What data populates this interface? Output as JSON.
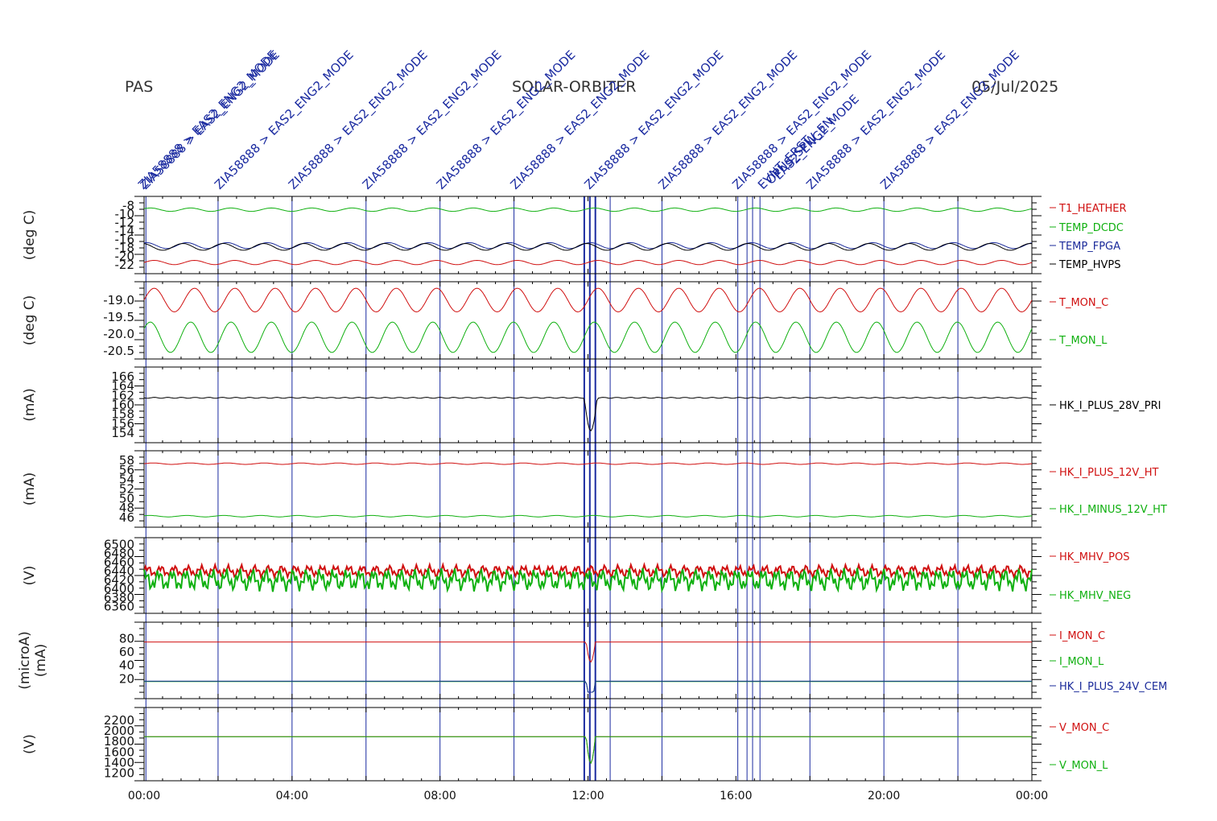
{
  "header": {
    "left": "PAS",
    "center": "SOLAR-ORBITER",
    "right": "05/Jul/2025"
  },
  "colors": {
    "red": "#d01010",
    "green": "#10b010",
    "blue": "#1a2a9a",
    "black": "#000000",
    "event": "#1a2aa0"
  },
  "events": {
    "label_text": "ZIA58888 > EAS2_ENG2_MODE",
    "times_hours": [
      2,
      4,
      6,
      8,
      10,
      12,
      14,
      16,
      18,
      20,
      22
    ],
    "lines_hours": [
      0.05,
      2.0,
      4.0,
      6.0,
      8.0,
      10.0,
      11.9,
      12.05,
      12.2,
      12.6,
      14.0,
      16.05,
      16.3,
      16.45,
      16.65,
      18.0,
      20.0,
      22.0
    ],
    "extra_labels": [
      "EVNT_ERST",
      "OPUS_SPW_EN",
      "EAS2_ENG2_MODE"
    ]
  },
  "chart_data": [
    {
      "type": "line",
      "panel": "temperatures",
      "ylabel": "(deg C)",
      "y_ticks": [
        "-8",
        "-10",
        "-12",
        "-14",
        "-16",
        "-18",
        "-20",
        "-22"
      ],
      "ylim": [
        -23,
        -7
      ],
      "series": [
        {
          "name": "T1_HEATHER",
          "color": "#d01010",
          "mean": -21.5,
          "amp": 0.5
        },
        {
          "name": "TEMP_DCDC",
          "color": "#10b010",
          "mean": -9.0,
          "amp": 0.4
        },
        {
          "name": "TEMP_FPGA",
          "color": "#1a2a9a",
          "mean": -17.5,
          "amp": 0.7
        },
        {
          "name": "TEMP_HVPS",
          "color": "#000000",
          "mean": -17.8,
          "amp": 0.8
        }
      ]
    },
    {
      "type": "line",
      "panel": "monitor temperatures",
      "ylabel": "(deg C)",
      "y_ticks": [
        "-19.0",
        "-19.5",
        "-20.0",
        "-20.5"
      ],
      "ylim": [
        -20.6,
        -18.6
      ],
      "series": [
        {
          "name": "T_MON_C",
          "color": "#d01010",
          "mean": -19.0,
          "amp": 0.35
        },
        {
          "name": "T_MON_L",
          "color": "#10b010",
          "mean": -20.1,
          "amp": 0.45
        }
      ]
    },
    {
      "type": "line",
      "panel": "28V current",
      "ylabel": "(mA)",
      "y_ticks": [
        "166",
        "164",
        "162",
        "160",
        "158",
        "156",
        "154"
      ],
      "ylim": [
        153,
        167
      ],
      "series": [
        {
          "name": "HK_I_PLUS_28V_PRI",
          "color": "#000000",
          "mean": 161.5,
          "amp": 0.1
        }
      ]
    },
    {
      "type": "line",
      "panel": "12V currents",
      "ylabel": "(mA)",
      "y_ticks": [
        "58",
        "56",
        "54",
        "52",
        "50",
        "48",
        "46"
      ],
      "ylim": [
        45,
        59
      ],
      "series": [
        {
          "name": "HK_I_PLUS_12V_HT",
          "color": "#d01010",
          "mean": 57.3,
          "amp": 0.15
        },
        {
          "name": "HK_I_MINUS_12V_HT",
          "color": "#10b010",
          "mean": 46.3,
          "amp": 0.15
        }
      ]
    },
    {
      "type": "line",
      "panel": "MHV voltages",
      "ylabel": "(V)",
      "y_ticks": [
        "6500",
        "6480",
        "6460",
        "6440",
        "6420",
        "6400",
        "6380",
        "6360"
      ],
      "ylim": [
        6355,
        6505
      ],
      "series": [
        {
          "name": "HK_MHV_POS",
          "color": "#d01010",
          "mean": 6440,
          "amp": 8
        },
        {
          "name": "HK_MHV_NEG",
          "color": "#10b010",
          "mean": 6420,
          "amp": 15
        }
      ]
    },
    {
      "type": "line",
      "panel": "currents",
      "ylabel": "(microA)",
      "ylabel2": "(mA)",
      "y_ticks": [
        "80",
        "60",
        "40",
        "20"
      ],
      "ylim": [
        0,
        95
      ],
      "series": [
        {
          "name": "I_MON_C",
          "color": "#d01010",
          "mean": 75,
          "amp": 0
        },
        {
          "name": "I_MON_L",
          "color": "#10b010",
          "mean": 16,
          "amp": 0
        },
        {
          "name": "HK_I_PLUS_24V_CEM",
          "color": "#1a2a9a",
          "mean": 16.5,
          "amp": 0
        }
      ]
    },
    {
      "type": "line",
      "panel": "monitor voltages",
      "ylabel": "(V)",
      "y_ticks": [
        "2200",
        "2000",
        "1800",
        "1600",
        "1400",
        "1200"
      ],
      "ylim": [
        1150,
        2350
      ],
      "series": [
        {
          "name": "V_MON_C",
          "color": "#d01010",
          "mean": 1890,
          "amp": 0
        },
        {
          "name": "V_MON_L",
          "color": "#10b010",
          "mean": 1890,
          "amp": 0
        }
      ]
    }
  ],
  "x_axis": {
    "tick_labels": [
      "00:00",
      "04:00",
      "08:00",
      "12:00",
      "16:00",
      "20:00",
      "00:00"
    ]
  }
}
